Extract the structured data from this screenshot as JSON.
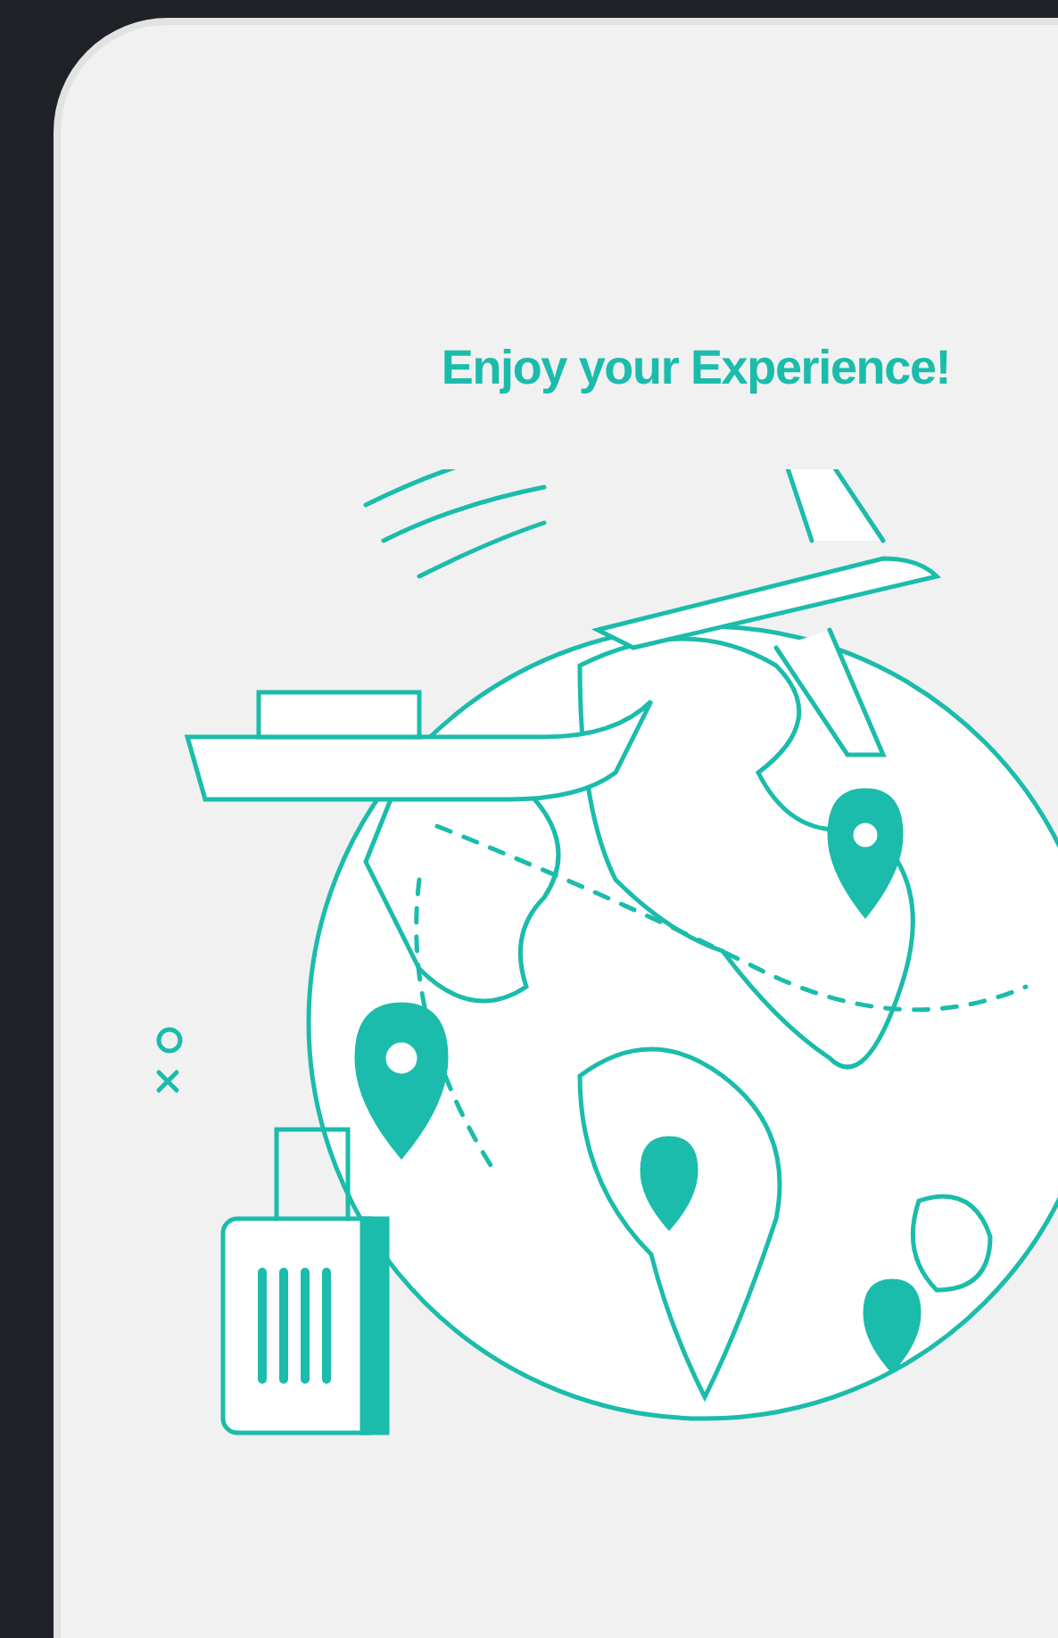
{
  "card": {
    "title": "Enjoy your Experience!"
  }
}
